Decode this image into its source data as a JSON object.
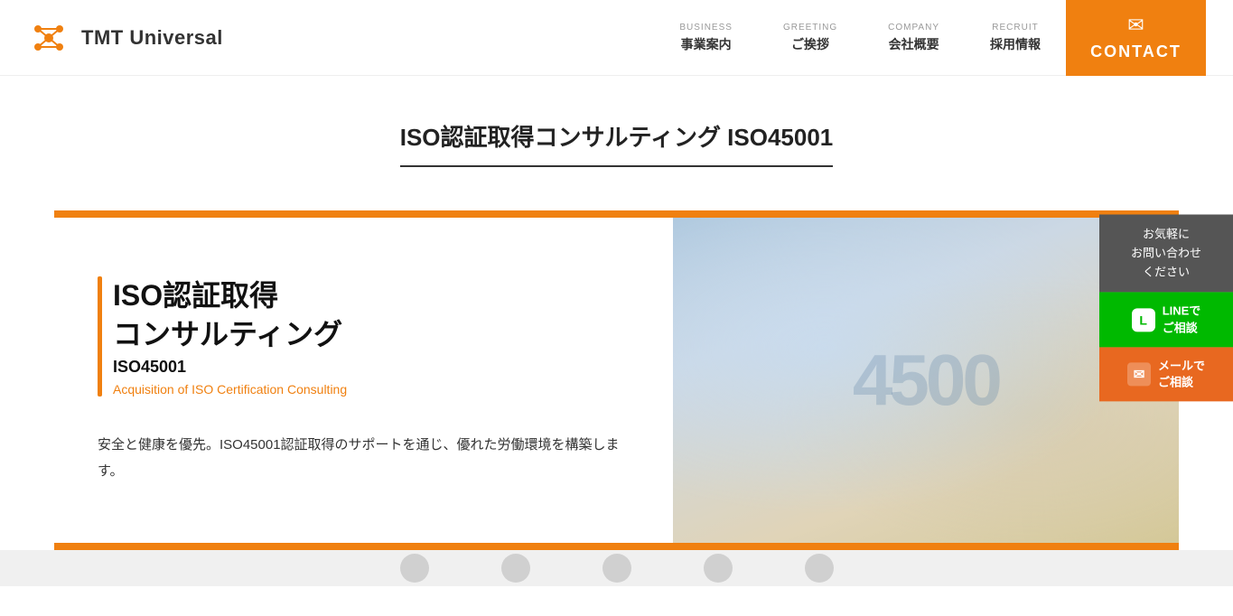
{
  "header": {
    "logo_text": "TMT Universal",
    "nav_items": [
      {
        "id": "business",
        "label_en": "BUSINESS",
        "label_ja": "事業案内"
      },
      {
        "id": "greeting",
        "label_en": "GREETING",
        "label_ja": "ご挨拶"
      },
      {
        "id": "company",
        "label_en": "COMPANY",
        "label_ja": "会社概要"
      },
      {
        "id": "recruit",
        "label_en": "RECRUIT",
        "label_ja": "採用情報"
      }
    ],
    "contact": {
      "label": "CONTACT"
    }
  },
  "page": {
    "title": "ISO認証取得コンサルティング ISO45001"
  },
  "banner": {
    "title_line1": "ISO認証取得",
    "title_line2": "コンサルティング",
    "subtitle_iso": "ISO45001",
    "subtitle_en": "Acquisition of ISO Certification Consulting",
    "description": "安全と健康を優先。ISO45001認証取得のサポートを通じ、優れた労働環境を構築します。"
  },
  "side_panel": {
    "header_text": "お気軽に\nお問い合わせ\nください",
    "line_btn_label": "LINEで\nご相談",
    "mail_btn_label": "メールで\nご相談"
  },
  "colors": {
    "accent": "#f08010",
    "contact_bg": "#f08010",
    "line_green": "#00b900",
    "mail_orange": "#e86820",
    "panel_gray": "#555555"
  }
}
